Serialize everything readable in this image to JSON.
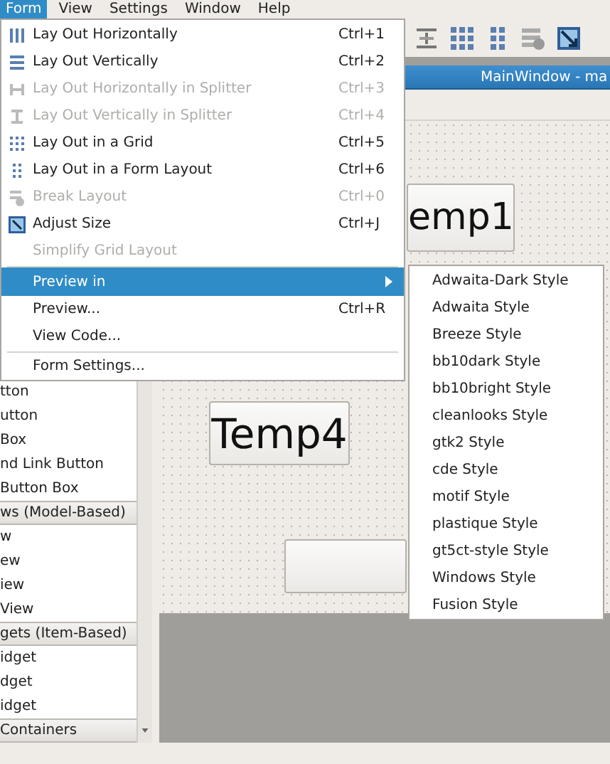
{
  "menubar": [
    {
      "label": "Form",
      "selected": true
    },
    {
      "label": "View",
      "selected": false
    },
    {
      "label": "Settings",
      "selected": false
    },
    {
      "label": "Window",
      "selected": false
    },
    {
      "label": "Help",
      "selected": false
    }
  ],
  "form_menu": [
    {
      "kind": "item",
      "label": "Lay Out Horizontally",
      "shortcut": "Ctrl+1",
      "disabled": false,
      "selected": false
    },
    {
      "kind": "item",
      "label": "Lay Out Vertically",
      "shortcut": "Ctrl+2",
      "disabled": false,
      "selected": false
    },
    {
      "kind": "item",
      "label": "Lay Out Horizontally in Splitter",
      "shortcut": "Ctrl+3",
      "disabled": true,
      "selected": false
    },
    {
      "kind": "item",
      "label": "Lay Out Vertically in Splitter",
      "shortcut": "Ctrl+4",
      "disabled": true,
      "selected": false
    },
    {
      "kind": "item",
      "label": "Lay Out in a Grid",
      "shortcut": "Ctrl+5",
      "disabled": false,
      "selected": false
    },
    {
      "kind": "item",
      "label": "Lay Out in a Form Layout",
      "shortcut": "Ctrl+6",
      "disabled": false,
      "selected": false
    },
    {
      "kind": "item",
      "label": "Break Layout",
      "shortcut": "Ctrl+0",
      "disabled": true,
      "selected": false
    },
    {
      "kind": "item",
      "label": "Adjust Size",
      "shortcut": "Ctrl+J",
      "disabled": false,
      "selected": false
    },
    {
      "kind": "item",
      "label": "Simplify Grid Layout",
      "disabled": true,
      "selected": false
    },
    {
      "kind": "separator"
    },
    {
      "kind": "submenu",
      "label": "Preview in",
      "disabled": false,
      "selected": true
    },
    {
      "kind": "item",
      "label": "Preview...",
      "shortcut": "Ctrl+R",
      "disabled": false,
      "selected": false
    },
    {
      "kind": "item",
      "label": "View Code...",
      "disabled": false,
      "selected": false
    },
    {
      "kind": "separator"
    },
    {
      "kind": "item",
      "label": "Form Settings...",
      "disabled": false,
      "selected": false
    }
  ],
  "preview_submenu": [
    "Adwaita-Dark Style",
    "Adwaita Style",
    "Breeze Style",
    "bb10dark Style",
    "bb10bright Style",
    "cleanlooks Style",
    "gtk2 Style",
    "cde Style",
    "motif Style",
    "plastique Style",
    "gt5ct-style Style",
    "Windows Style",
    "Fusion Style"
  ],
  "widget_box": [
    {
      "kind": "item",
      "label": "tton"
    },
    {
      "kind": "item",
      "label": "utton"
    },
    {
      "kind": "item",
      "label": "Box"
    },
    {
      "kind": "item",
      "label": "nd Link Button"
    },
    {
      "kind": "item",
      "label": "Button Box"
    },
    {
      "kind": "category",
      "label": "ws (Model-Based)"
    },
    {
      "kind": "item",
      "label": "w"
    },
    {
      "kind": "item",
      "label": "ew"
    },
    {
      "kind": "item",
      "label": "iew"
    },
    {
      "kind": "item",
      "label": " View"
    },
    {
      "kind": "category",
      "label": "gets (Item-Based)"
    },
    {
      "kind": "item",
      "label": "idget"
    },
    {
      "kind": "item",
      "label": "dget"
    },
    {
      "kind": "item",
      "label": "idget"
    },
    {
      "kind": "category",
      "label": "Containers"
    }
  ],
  "form_window": {
    "title": "MainWindow - ma",
    "widgets": [
      {
        "kind": "button",
        "label": "emp1"
      },
      {
        "kind": "button",
        "label": "Temp4"
      },
      {
        "kind": "button"
      }
    ]
  }
}
